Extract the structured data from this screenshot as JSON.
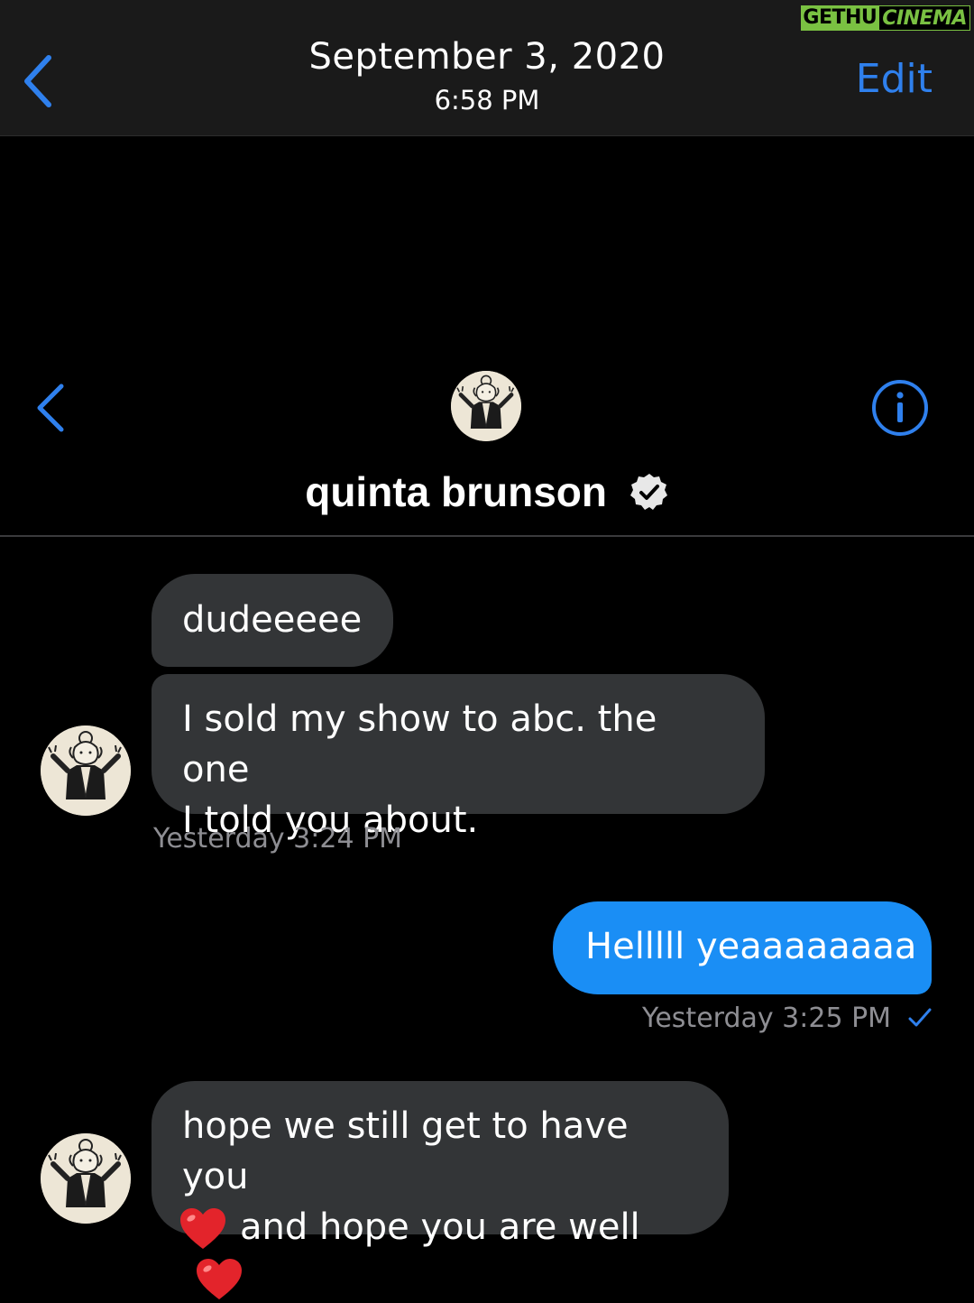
{
  "photos_bar": {
    "date": "September 3, 2020",
    "time": "6:58 PM",
    "edit_label": "Edit",
    "back_icon": "chevron-left-icon"
  },
  "watermark": {
    "part1": "GETHU",
    "part2": "CINEMA"
  },
  "chat_header": {
    "contact_name": "quinta brunson",
    "verified_icon": "verified-badge-icon",
    "info_icon": "info-icon",
    "back_icon": "chevron-left-icon"
  },
  "messages": [
    {
      "sender": "them",
      "text": "dudeeeee"
    },
    {
      "sender": "them",
      "text_line1": "I sold my show to abc. the one",
      "text_line2": "I told you about."
    },
    {
      "sender": "me",
      "text": "Helllll yeaaaaaaaa"
    },
    {
      "sender": "them",
      "text_line1": "hope we still get to have you",
      "text_line2": "and hope you are well"
    }
  ],
  "timestamps": {
    "first": "Yesterday 3:24 PM",
    "second": "Yesterday 3:25 PM"
  },
  "colors": {
    "accent_blue": "#2f80ed",
    "sent_bubble": "#1a8ef5",
    "received_bubble": "#333537",
    "timestamp_gray": "#8e8e93",
    "heart_red": "#e3242b"
  }
}
